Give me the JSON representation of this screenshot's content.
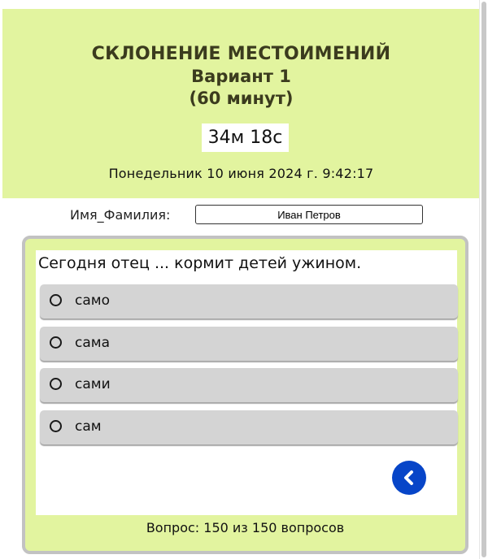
{
  "header": {
    "title": "СКЛОНЕНИЕ МЕСТОИМЕНИЙ",
    "variant": "Вариант 1",
    "duration": "(60 минут)",
    "timer": "34м 18с",
    "datetime": "Понедельник 10 июня 2024 г. 9:42:17",
    "background_color": "#e2f49f"
  },
  "student": {
    "label": "Имя_Фамилия:",
    "value": "Иван Петров"
  },
  "quiz": {
    "question": "Сегодня отец ... кормит детей ужином.",
    "options": [
      {
        "label": "само"
      },
      {
        "label": "сама"
      },
      {
        "label": "сами"
      },
      {
        "label": "сам"
      }
    ],
    "back_icon": "chevron-left-icon",
    "back_button_color": "#0745c8",
    "progress": "Вопрос: 150 из 150 вопросов"
  }
}
